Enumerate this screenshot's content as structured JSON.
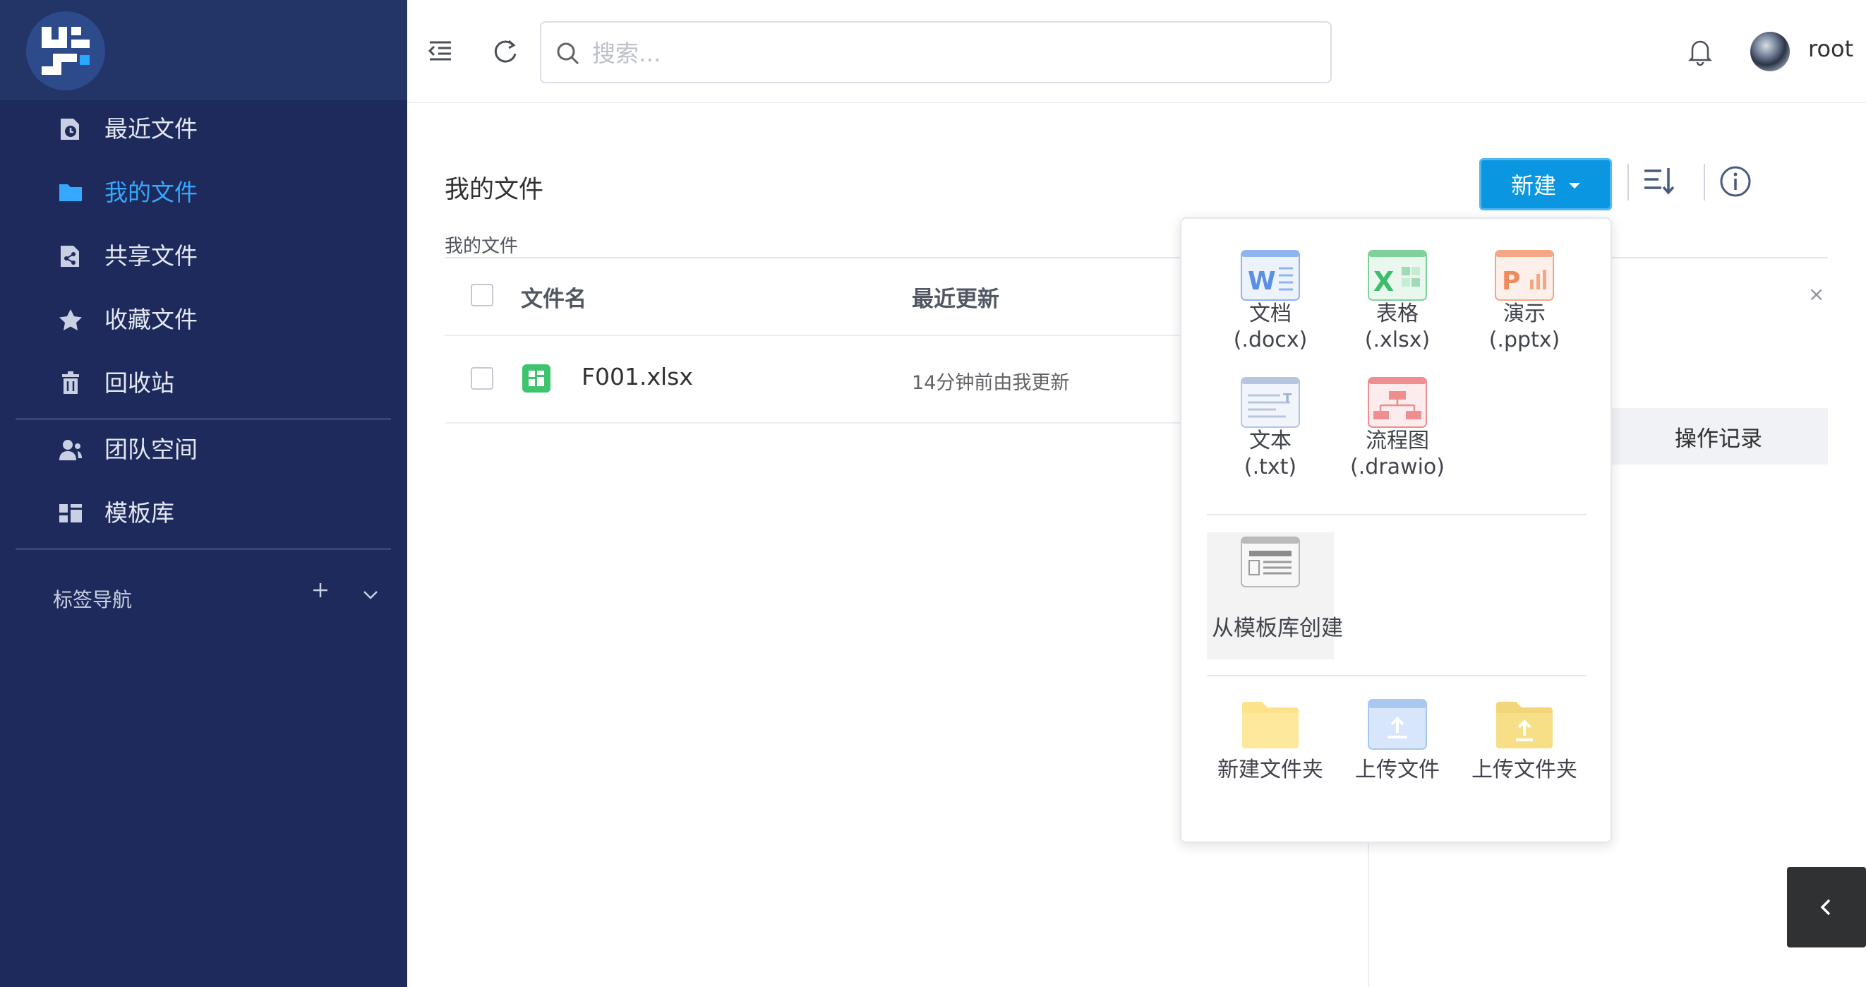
{
  "sidebar": {
    "items": [
      {
        "label": "最近文件",
        "icon": "recent-file-icon"
      },
      {
        "label": "我的文件",
        "icon": "folder-icon",
        "active": true
      },
      {
        "label": "共享文件",
        "icon": "share-file-icon"
      },
      {
        "label": "收藏文件",
        "icon": "star-icon"
      },
      {
        "label": "回收站",
        "icon": "trash-icon"
      },
      {
        "label": "团队空间",
        "icon": "team-icon"
      },
      {
        "label": "模板库",
        "icon": "template-icon"
      }
    ],
    "tag_nav": "标签导航"
  },
  "header": {
    "search_placeholder": "搜索...",
    "username": "root"
  },
  "main": {
    "title": "我的文件",
    "breadcrumb": "我的文件",
    "new_button": "新建",
    "columns": {
      "name": "文件名",
      "updated": "最近更新"
    },
    "rows": [
      {
        "name": "F001.xlsx",
        "updated": "14分钟前由我更新",
        "type": "xlsx"
      }
    ]
  },
  "panel": {
    "close": "×",
    "op_log": "操作记录"
  },
  "dropdown": {
    "docx": {
      "l1": "文档",
      "l2": "(.docx)"
    },
    "xlsx": {
      "l1": "表格",
      "l2": "(.xlsx)"
    },
    "pptx": {
      "l1": "演示",
      "l2": "(.pptx)"
    },
    "txt": {
      "l1": "文本",
      "l2": "(.txt)"
    },
    "drawio": {
      "l1": "流程图",
      "l2": "(.drawio)"
    },
    "template": "从模板库创建",
    "new_folder": "新建文件夹",
    "upload_file": "上传文件",
    "upload_folder": "上传文件夹"
  },
  "colors": {
    "sidebar_bg": "#1d2a5b",
    "accent": "#0a96e0",
    "active_nav": "#35a8ff"
  }
}
